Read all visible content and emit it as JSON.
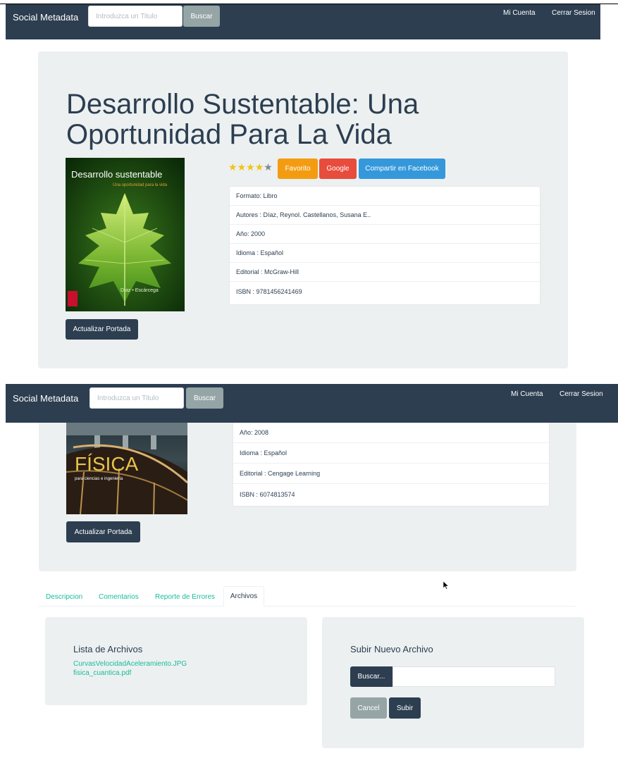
{
  "nav": {
    "brand": "Social Metadata",
    "search_placeholder": "Introduzca un Titulo",
    "search_button": "Buscar",
    "account": "Mi Cuenta",
    "logout": "Cerrar Sesion"
  },
  "book1": {
    "title_line1": "Desarrollo Sustentable: Una",
    "title_line2": "Oportunidad Para La Vida",
    "cover_title": "Desarrollo sustentable",
    "cover_subtitle": "Una oportunidad para la vida",
    "cover_authors": "Díaz • Escárcega",
    "rating": 4,
    "rating_max": 5,
    "favorite_button": "Favorito",
    "google_button": "Google",
    "facebook_button": "Compartir en Facebook",
    "details": [
      "Formato: Libro",
      "Autores : Díaz, Reynol. Castellanos, Susana E..",
      "Año: 2000",
      "Idioma : Español",
      "Editorial : McGraw-Hill",
      "ISBN : 9781456241469"
    ],
    "update_cover_button": "Actualizar Portada"
  },
  "book2": {
    "cover_title": "FÍSICA",
    "cover_subtitle": "para ciencias e ingeniería",
    "details": [
      "Año: 2008",
      "Idioma : Español",
      "Editorial : Cengage Learning",
      "ISBN : 6074813574"
    ],
    "update_cover_button": "Actualizar Portada"
  },
  "tabs": [
    "Descripcion",
    "Comentarios",
    "Reporte de Errores",
    "Archivos"
  ],
  "active_tab": "Archivos",
  "files": {
    "heading": "Lista de Archivos",
    "items": [
      "CurvasVelocidadAceleramiento.JPG",
      "fisica_cuantica.pdf"
    ]
  },
  "upload": {
    "heading": "Subir Nuevo Archivo",
    "browse_button": "Buscar...",
    "cancel_button": "Cancel",
    "submit_button": "Subir"
  },
  "colors": {
    "primary": "#2c3e50",
    "success": "#18bc9c",
    "warning": "#f39c12",
    "danger": "#e74c3c",
    "info": "#3498db",
    "muted": "#95a5a6",
    "light": "#ecf0f1"
  }
}
